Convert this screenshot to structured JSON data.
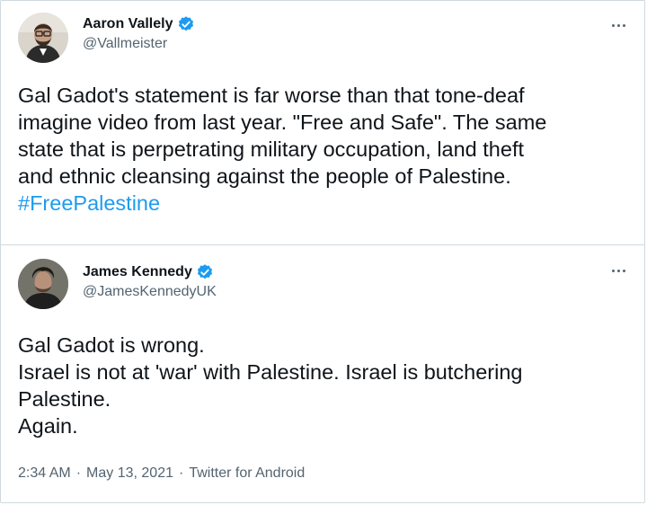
{
  "tweets": [
    {
      "display_name": "Aaron Vallely",
      "handle": "@Vallmeister",
      "text": "Gal Gadot's statement is far worse than that tone-deaf\nimagine video from last year. \"Free and Safe\". The same\nstate that is perpetrating military occupation, land theft\nand ethnic cleansing against the people of Palestine.",
      "hashtag": "#FreePalestine"
    },
    {
      "display_name": "James Kennedy",
      "handle": "@JamesKennedyUK",
      "text": "Gal Gadot is wrong.\nIsrael is not at 'war' with Palestine. Israel is butchering\nPalestine.\nAgain.",
      "time": "2:34 AM",
      "date": "May 13, 2021",
      "source": "Twitter for Android",
      "separator": "·"
    }
  ],
  "colors": {
    "link": "#1d9bf0",
    "verified": "#1d9bf0",
    "secondary_text": "#536471",
    "border": "#cfd9de"
  },
  "icons": {
    "verified": "verified-badge-icon",
    "more": "more-options-icon"
  }
}
